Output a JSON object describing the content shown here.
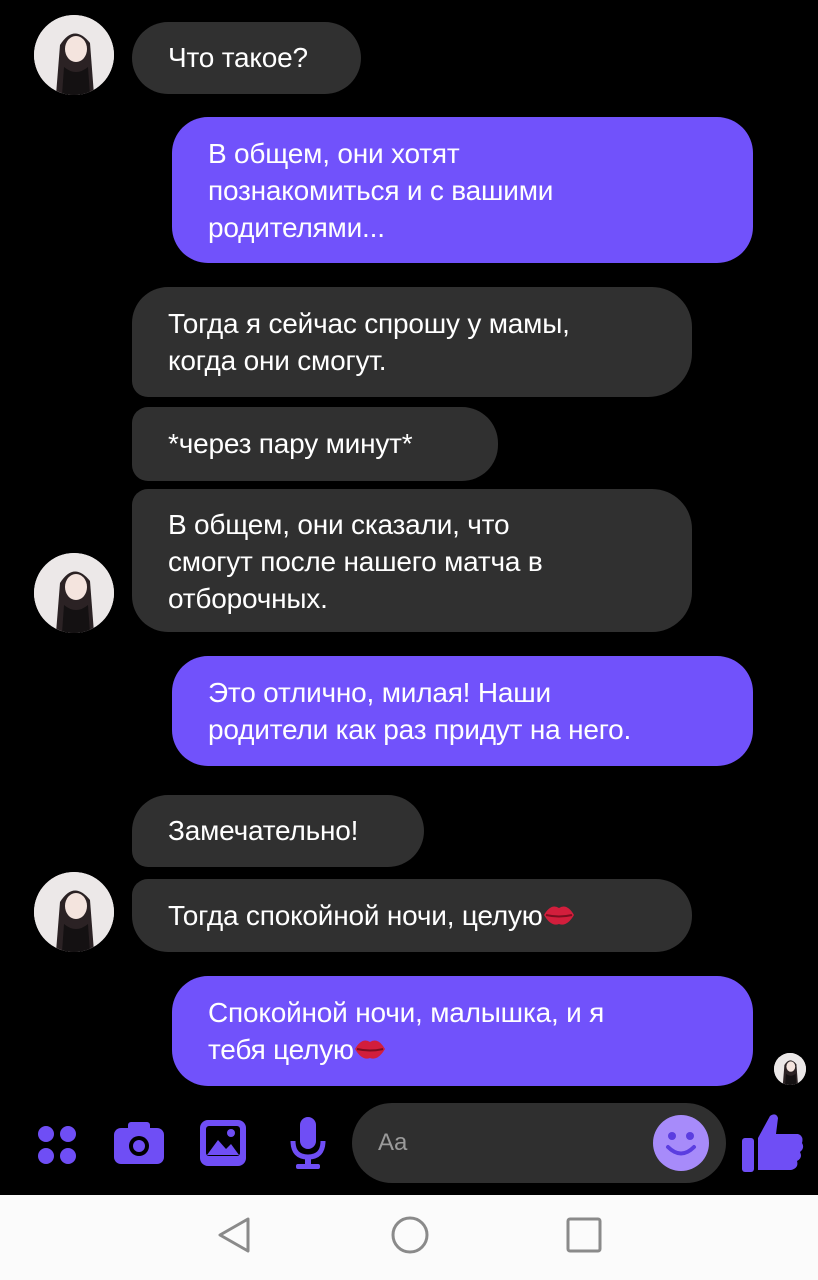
{
  "messages": [
    {
      "side": "in",
      "text": "Что такое?"
    },
    {
      "side": "out",
      "lines": [
        "В общем, они хотят",
        "познакомиться и с вашими",
        "родителями..."
      ]
    },
    {
      "side": "in",
      "lines": [
        "Тогда я сейчас спрошу у мамы,",
        "когда они смогут."
      ]
    },
    {
      "side": "in",
      "text": "*через пару минут*"
    },
    {
      "side": "in",
      "lines": [
        "В общем, они сказали, что",
        "смогут после нашего матча в",
        "отборочных."
      ]
    },
    {
      "side": "out",
      "lines": [
        "Это отлично, милая! Наши",
        "родители как раз придут на него."
      ]
    },
    {
      "side": "in",
      "text": "Замечательно!"
    },
    {
      "side": "in",
      "text": "Тогда спокойной ночи, целую",
      "emoji": "kiss-mark"
    },
    {
      "side": "out",
      "lines": [
        "Спокойной ночи, малышка, и я",
        "тебя целую"
      ],
      "emoji": "kiss-mark"
    }
  ],
  "composer": {
    "placeholder": "Aa",
    "icons": [
      "menu-dots-icon",
      "camera-icon",
      "gallery-icon",
      "microphone-icon",
      "emoji-icon",
      "thumbs-up-icon"
    ]
  },
  "navbar": {
    "icons": [
      "back-triangle-icon",
      "home-circle-icon",
      "recents-square-icon"
    ]
  },
  "colors": {
    "accent": "#7152fb",
    "incoming_bubble": "#303030",
    "background": "#000000",
    "icon": "#6f4ef5",
    "emoji_bg": "#a78bfa"
  }
}
